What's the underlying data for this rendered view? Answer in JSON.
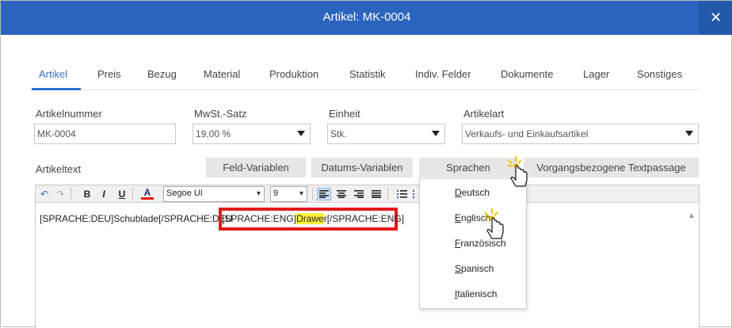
{
  "window": {
    "title": "Artikel: MK-0004",
    "close_glyph": "✕"
  },
  "tabs": [
    {
      "label": "Artikel",
      "active": true
    },
    {
      "label": "Preis"
    },
    {
      "label": "Bezug"
    },
    {
      "label": "Material"
    },
    {
      "label": "Produktion"
    },
    {
      "label": "Statistik"
    },
    {
      "label": "Indiv. Felder"
    },
    {
      "label": "Dokumente"
    },
    {
      "label": "Lager"
    },
    {
      "label": "Sonstiges"
    }
  ],
  "fields": {
    "artikelnummer": {
      "label": "Artikelnummer",
      "value": "MK-0004"
    },
    "mwst": {
      "label": "MwSt.-Satz",
      "value": "19,00 %"
    },
    "einheit": {
      "label": "Einheit",
      "value": "Stk."
    },
    "artikelart": {
      "label": "Artikelart",
      "value": "Verkaufs- und Einkaufsartikel"
    }
  },
  "artikeltext": {
    "label": "Artikeltext",
    "buttons": {
      "feld": "Feld-Variablen",
      "datum": "Datums-Variablen",
      "sprachen": "Sprachen",
      "vorgang": "Vorgangsbezogene Textpassage"
    },
    "toolbar": {
      "undo": "↶",
      "redo": "↷",
      "bold": "B",
      "italic": "I",
      "underline": "U",
      "font_color": "A",
      "font": "Segoe UI",
      "size": "9"
    },
    "content_before": "[SPRACHE:DEU]Schublade[/SPRACHE:DEU",
    "content_hl_1": "[SPRACHE:ENG]",
    "content_hl_mark": "Drawe",
    "content_hl_2": "r[/SPRACHE:ENG]"
  },
  "language_menu": {
    "items": [
      {
        "first": "D",
        "rest": "eutsch"
      },
      {
        "first": "E",
        "rest": "nglisch"
      },
      {
        "first": "F",
        "rest": "ranzösisch"
      },
      {
        "first": "S",
        "rest": "panisch"
      },
      {
        "first": "I",
        "rest": "talienisch"
      }
    ]
  },
  "colors": {
    "accent": "#2b64be",
    "tab_active": "#2e6fcf",
    "highlight_box": "#e11b1b",
    "mark": "#fff23a"
  }
}
